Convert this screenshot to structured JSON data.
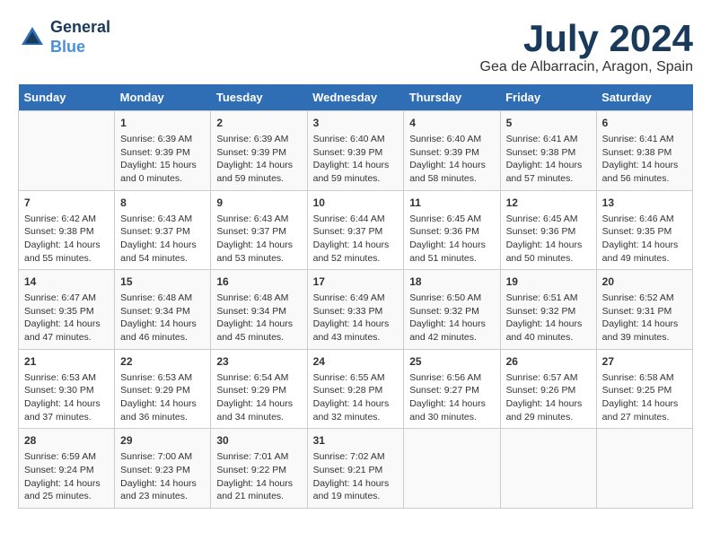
{
  "header": {
    "logo_line1": "General",
    "logo_line2": "Blue",
    "month_title": "July 2024",
    "location": "Gea de Albarracin, Aragon, Spain"
  },
  "calendar": {
    "days_of_week": [
      "Sunday",
      "Monday",
      "Tuesday",
      "Wednesday",
      "Thursday",
      "Friday",
      "Saturday"
    ],
    "weeks": [
      [
        {
          "day": "",
          "info": ""
        },
        {
          "day": "1",
          "info": "Sunrise: 6:39 AM\nSunset: 9:39 PM\nDaylight: 15 hours\nand 0 minutes."
        },
        {
          "day": "2",
          "info": "Sunrise: 6:39 AM\nSunset: 9:39 PM\nDaylight: 14 hours\nand 59 minutes."
        },
        {
          "day": "3",
          "info": "Sunrise: 6:40 AM\nSunset: 9:39 PM\nDaylight: 14 hours\nand 59 minutes."
        },
        {
          "day": "4",
          "info": "Sunrise: 6:40 AM\nSunset: 9:39 PM\nDaylight: 14 hours\nand 58 minutes."
        },
        {
          "day": "5",
          "info": "Sunrise: 6:41 AM\nSunset: 9:38 PM\nDaylight: 14 hours\nand 57 minutes."
        },
        {
          "day": "6",
          "info": "Sunrise: 6:41 AM\nSunset: 9:38 PM\nDaylight: 14 hours\nand 56 minutes."
        }
      ],
      [
        {
          "day": "7",
          "info": "Sunrise: 6:42 AM\nSunset: 9:38 PM\nDaylight: 14 hours\nand 55 minutes."
        },
        {
          "day": "8",
          "info": "Sunrise: 6:43 AM\nSunset: 9:37 PM\nDaylight: 14 hours\nand 54 minutes."
        },
        {
          "day": "9",
          "info": "Sunrise: 6:43 AM\nSunset: 9:37 PM\nDaylight: 14 hours\nand 53 minutes."
        },
        {
          "day": "10",
          "info": "Sunrise: 6:44 AM\nSunset: 9:37 PM\nDaylight: 14 hours\nand 52 minutes."
        },
        {
          "day": "11",
          "info": "Sunrise: 6:45 AM\nSunset: 9:36 PM\nDaylight: 14 hours\nand 51 minutes."
        },
        {
          "day": "12",
          "info": "Sunrise: 6:45 AM\nSunset: 9:36 PM\nDaylight: 14 hours\nand 50 minutes."
        },
        {
          "day": "13",
          "info": "Sunrise: 6:46 AM\nSunset: 9:35 PM\nDaylight: 14 hours\nand 49 minutes."
        }
      ],
      [
        {
          "day": "14",
          "info": "Sunrise: 6:47 AM\nSunset: 9:35 PM\nDaylight: 14 hours\nand 47 minutes."
        },
        {
          "day": "15",
          "info": "Sunrise: 6:48 AM\nSunset: 9:34 PM\nDaylight: 14 hours\nand 46 minutes."
        },
        {
          "day": "16",
          "info": "Sunrise: 6:48 AM\nSunset: 9:34 PM\nDaylight: 14 hours\nand 45 minutes."
        },
        {
          "day": "17",
          "info": "Sunrise: 6:49 AM\nSunset: 9:33 PM\nDaylight: 14 hours\nand 43 minutes."
        },
        {
          "day": "18",
          "info": "Sunrise: 6:50 AM\nSunset: 9:32 PM\nDaylight: 14 hours\nand 42 minutes."
        },
        {
          "day": "19",
          "info": "Sunrise: 6:51 AM\nSunset: 9:32 PM\nDaylight: 14 hours\nand 40 minutes."
        },
        {
          "day": "20",
          "info": "Sunrise: 6:52 AM\nSunset: 9:31 PM\nDaylight: 14 hours\nand 39 minutes."
        }
      ],
      [
        {
          "day": "21",
          "info": "Sunrise: 6:53 AM\nSunset: 9:30 PM\nDaylight: 14 hours\nand 37 minutes."
        },
        {
          "day": "22",
          "info": "Sunrise: 6:53 AM\nSunset: 9:29 PM\nDaylight: 14 hours\nand 36 minutes."
        },
        {
          "day": "23",
          "info": "Sunrise: 6:54 AM\nSunset: 9:29 PM\nDaylight: 14 hours\nand 34 minutes."
        },
        {
          "day": "24",
          "info": "Sunrise: 6:55 AM\nSunset: 9:28 PM\nDaylight: 14 hours\nand 32 minutes."
        },
        {
          "day": "25",
          "info": "Sunrise: 6:56 AM\nSunset: 9:27 PM\nDaylight: 14 hours\nand 30 minutes."
        },
        {
          "day": "26",
          "info": "Sunrise: 6:57 AM\nSunset: 9:26 PM\nDaylight: 14 hours\nand 29 minutes."
        },
        {
          "day": "27",
          "info": "Sunrise: 6:58 AM\nSunset: 9:25 PM\nDaylight: 14 hours\nand 27 minutes."
        }
      ],
      [
        {
          "day": "28",
          "info": "Sunrise: 6:59 AM\nSunset: 9:24 PM\nDaylight: 14 hours\nand 25 minutes."
        },
        {
          "day": "29",
          "info": "Sunrise: 7:00 AM\nSunset: 9:23 PM\nDaylight: 14 hours\nand 23 minutes."
        },
        {
          "day": "30",
          "info": "Sunrise: 7:01 AM\nSunset: 9:22 PM\nDaylight: 14 hours\nand 21 minutes."
        },
        {
          "day": "31",
          "info": "Sunrise: 7:02 AM\nSunset: 9:21 PM\nDaylight: 14 hours\nand 19 minutes."
        },
        {
          "day": "",
          "info": ""
        },
        {
          "day": "",
          "info": ""
        },
        {
          "day": "",
          "info": ""
        }
      ]
    ]
  }
}
